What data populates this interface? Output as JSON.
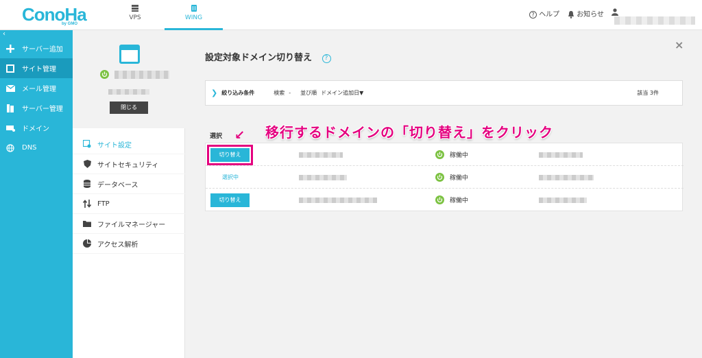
{
  "header": {
    "logo_text": "ConoHa",
    "logo_sub": "by GMO",
    "tabs": [
      {
        "label": "VPS",
        "icon": "server-icon"
      },
      {
        "label": "WING",
        "icon": "wing-icon"
      }
    ],
    "help_label": "ヘルプ",
    "notice_label": "お知らせ",
    "accent_color": "#29b6d8"
  },
  "sidebar": {
    "collapse_label": "‹",
    "items": [
      {
        "label": "サーバー追加",
        "icon": "plus-icon"
      },
      {
        "label": "サイト管理",
        "icon": "window-icon"
      },
      {
        "label": "メール管理",
        "icon": "mail-icon"
      },
      {
        "label": "サーバー管理",
        "icon": "server-icon"
      },
      {
        "label": "ドメイン",
        "icon": "domain-icon"
      },
      {
        "label": "DNS",
        "icon": "globe-icon"
      }
    ]
  },
  "server_panel": {
    "close_label": "閉じる",
    "menu": [
      {
        "label": "サイト設定",
        "icon": "site-settings-icon"
      },
      {
        "label": "サイトセキュリティ",
        "icon": "shield-icon"
      },
      {
        "label": "データベース",
        "icon": "database-icon"
      },
      {
        "label": "FTP",
        "icon": "transfer-icon"
      },
      {
        "label": "ファイルマネージャー",
        "icon": "folder-icon"
      },
      {
        "label": "アクセス解析",
        "icon": "pie-chart-icon"
      }
    ]
  },
  "main": {
    "title": "設定対象ドメイン切り替え",
    "help_icon": "?",
    "close_icon": "×",
    "filter": {
      "label": "絞り込み条件",
      "search_key": "検索",
      "search_value": "-",
      "sort_key": "並び順",
      "sort_value": "ドメイン追加日▼",
      "count": "該当 3件"
    },
    "table_header": {
      "select": "選択"
    },
    "rows": [
      {
        "action": "切り替え",
        "status": "稼働中"
      },
      {
        "action": "選択中",
        "status": "稼働中"
      },
      {
        "action": "切り替え",
        "status": "稼働中"
      }
    ],
    "annotation": "移行するドメインの「切り替え」をクリック",
    "annotation_arrow": "↙",
    "highlight_color": "#e4007f",
    "status_color": "#7cc242"
  }
}
